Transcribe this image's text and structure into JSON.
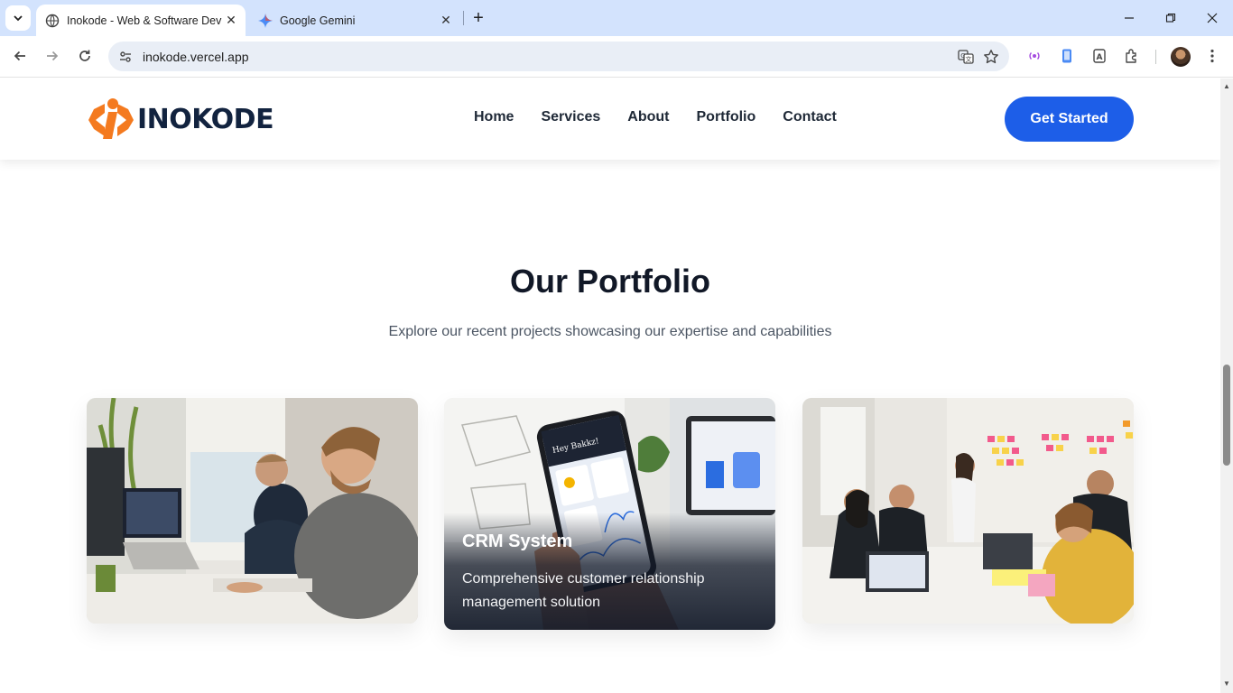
{
  "browser": {
    "tabs": [
      {
        "title": "Inokode - Web & Software Dev",
        "active": true,
        "favicon": "globe-icon"
      },
      {
        "title": "Google Gemini",
        "active": false,
        "favicon": "gemini-icon"
      }
    ],
    "url": "inokode.vercel.app"
  },
  "site": {
    "logo_text": "INOKODE",
    "nav": [
      "Home",
      "Services",
      "About",
      "Portfolio",
      "Contact"
    ],
    "cta_label": "Get Started",
    "colors": {
      "primary": "#1d5ee8",
      "logo_orange": "#f47a1f",
      "heading": "#111827"
    }
  },
  "portfolio": {
    "title": "Our Portfolio",
    "subtitle": "Explore our recent projects showcasing our expertise and capabilities",
    "cards": [
      {
        "image": "developers-at-desk-photo",
        "title": "",
        "description": ""
      },
      {
        "image": "smartphone-app-photo",
        "title": "CRM System",
        "description": "Comprehensive customer relationship management solution"
      },
      {
        "image": "team-meeting-photo",
        "title": "",
        "description": ""
      }
    ]
  }
}
